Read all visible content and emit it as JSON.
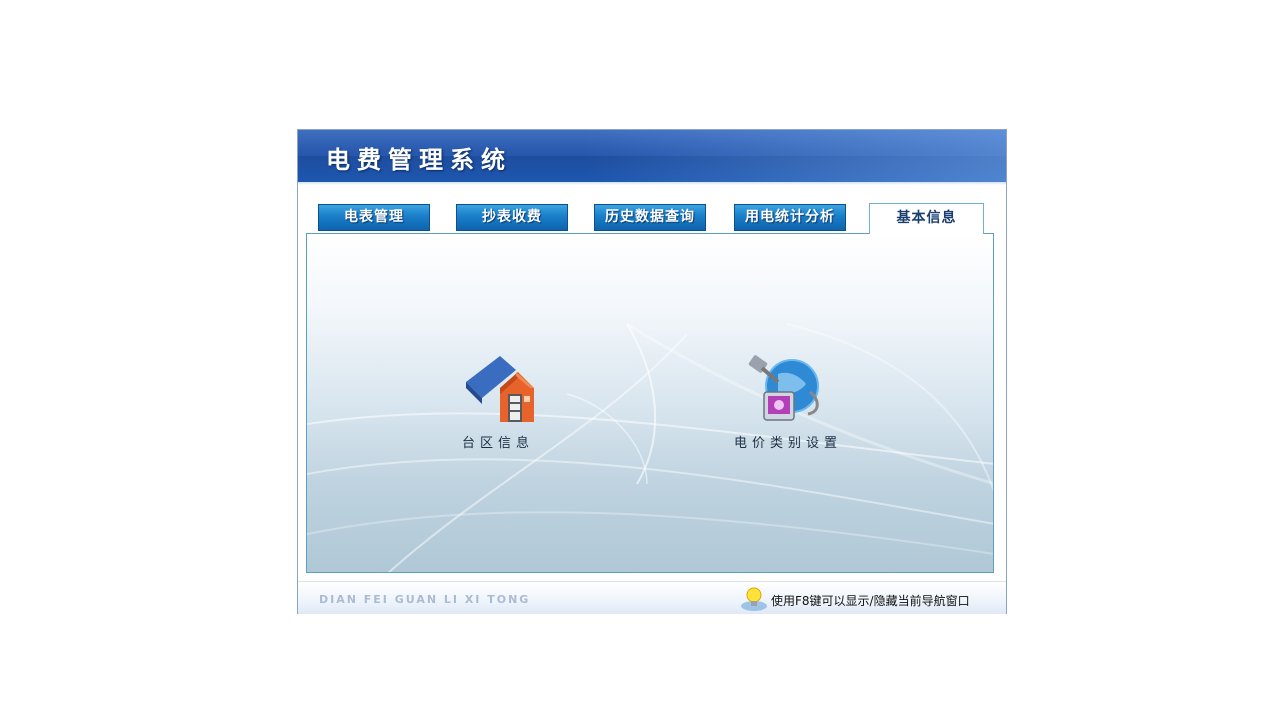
{
  "app": {
    "title": "电费管理系统",
    "brand_pinyin": "DIAN FEI GUAN LI XI TONG"
  },
  "tabs": [
    {
      "label": "电表管理",
      "active": false
    },
    {
      "label": "抄表收费",
      "active": false
    },
    {
      "label": "历史数据查询",
      "active": false
    },
    {
      "label": "用电统计分析",
      "active": false
    },
    {
      "label": "基本信息",
      "active": true
    }
  ],
  "launchers": [
    {
      "label": "台区信息",
      "icon": "house-icon"
    },
    {
      "label": "电价类别设置",
      "icon": "globe-plug-icon"
    }
  ],
  "footer": {
    "hint": "使用F8键可以显示/隐藏当前导航窗口",
    "hint_icon": "lightbulb-icon"
  },
  "colors": {
    "header": "#1f4fa3",
    "tab": "#1a7ec8",
    "active_tab_text": "#1a3e6e"
  }
}
